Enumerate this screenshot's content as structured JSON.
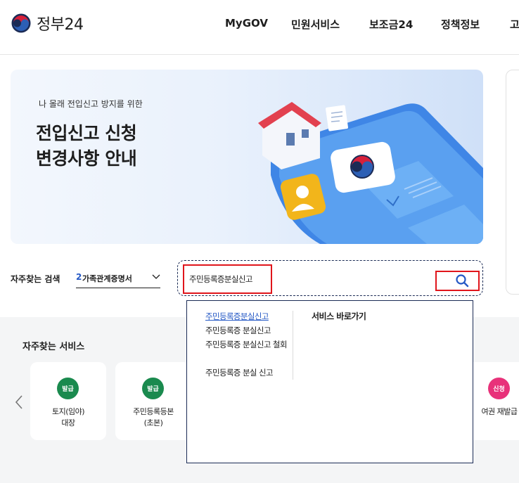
{
  "header": {
    "logo_text": "정부24",
    "nav": [
      "MyGOV",
      "민원서비스",
      "보조금24",
      "정책정보",
      "고"
    ]
  },
  "banner": {
    "subtitle": "나 몰래 전입신고 방지를 위한",
    "title_line1": "전입신고 신청",
    "title_line2": "변경사항 안내"
  },
  "search": {
    "frequent_label": "자주찾는 검색",
    "frequent_rank": "2",
    "frequent_value": "가족관계증명서",
    "input_value": "주민등록증분실신고",
    "suggestions": [
      "주민등록증분실신고",
      "주민등록증 분실신고",
      "주민등록증 분실신고 철회",
      "주민등록증 분실 신고"
    ],
    "shortcut_heading": "서비스 바로가기"
  },
  "services": {
    "title": "자주찾는 서비스",
    "cards": [
      {
        "badge": "발급",
        "label_line1": "토지(임야)",
        "label_line2": "대장",
        "color": "#1a8a4e"
      },
      {
        "badge": "발급",
        "label_line1": "주민등록등본",
        "label_line2": "(초본)",
        "color": "#1a8a4e"
      },
      {
        "badge": "신청",
        "label_line1": "여권 재발급",
        "label_line2": "",
        "color": "#e8327a"
      }
    ]
  },
  "colors": {
    "accent_blue": "#2559c5",
    "highlight_red": "#e0151b",
    "navy": "#1b2b55"
  }
}
